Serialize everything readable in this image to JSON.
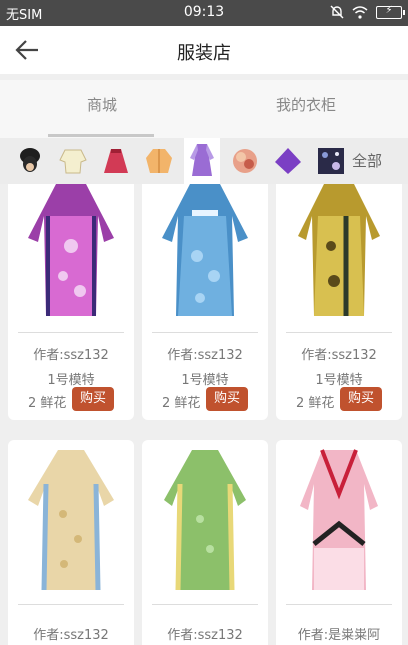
{
  "status_bar": {
    "carrier": "无SIM",
    "time": "09:13"
  },
  "header": {
    "title": "服装店"
  },
  "tabs": [
    {
      "label": "商城"
    },
    {
      "label": "我的衣柜"
    }
  ],
  "categories": {
    "items": [
      "hair-bun-icon",
      "top-icon",
      "skirt-icon",
      "robe-icon",
      "dress-icon",
      "flower-icon",
      "cape-icon",
      "pattern-icon"
    ],
    "selected_index": 4,
    "all_label": "全部"
  },
  "products": [
    {
      "author": "作者:ssz132",
      "model": "1号模特",
      "price": "2 鲜花",
      "buy": "购买",
      "color": "#9b3fa8"
    },
    {
      "author": "作者:ssz132",
      "model": "1号模特",
      "price": "2 鲜花",
      "buy": "购买",
      "color": "#4a90c8"
    },
    {
      "author": "作者:ssz132",
      "model": "1号模特",
      "price": "2 鲜花",
      "buy": "购买",
      "color": "#b89a2e"
    },
    {
      "author": "作者:ssz132",
      "color": "#e9d6a8"
    },
    {
      "author": "作者:ssz132",
      "color": "#8cc06a"
    },
    {
      "author": "作者:是粜粜阿",
      "color": "#f2b6c6"
    }
  ]
}
